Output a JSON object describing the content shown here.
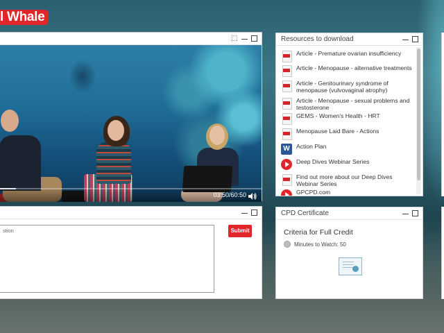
{
  "brand": {
    "logo_text": "l Whale"
  },
  "video": {
    "time": "03:50/60:50",
    "progress_fraction": 0.063
  },
  "resources": {
    "title": "Resources to download",
    "items": [
      {
        "label": "Article - Premature ovarian insufficiency",
        "icon": "pdf-icon"
      },
      {
        "label": "Article - Menopause - alternative treatments",
        "icon": "pdf-icon"
      },
      {
        "label": "Article - Genitourinary syndrome of menopause (vulvovaginal atrophy)",
        "icon": "pdf-icon"
      },
      {
        "label": "Article - Menopause - sexual problems and testosterone",
        "icon": "pdf-icon"
      },
      {
        "label": "GEMS - Women's Health - HRT",
        "icon": "pdf-icon"
      },
      {
        "label": "Menopause Laid Bare - Actions",
        "icon": "pdf-icon"
      },
      {
        "label": "Action Plan",
        "icon": "word-icon"
      },
      {
        "label": "Deep Dives Webinar Series",
        "icon": "play-icon"
      },
      {
        "label": "Find out more about our Deep Dives Webinar Series",
        "icon": "pdf-icon"
      },
      {
        "label": "GPCPD.com",
        "icon": "play-icon"
      }
    ]
  },
  "question": {
    "placeholder": "stion",
    "submit_label": "Submit"
  },
  "cpd": {
    "title": "CPD Certificate",
    "heading": "Criteria for Full Credit",
    "minutes_label": "Minutes to Watch: 50"
  }
}
